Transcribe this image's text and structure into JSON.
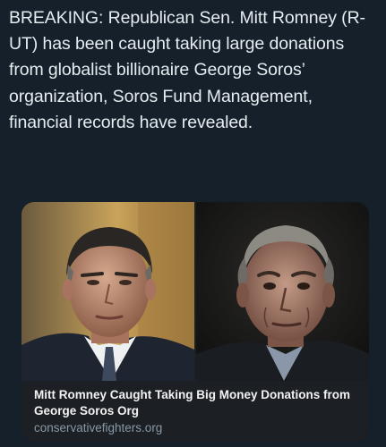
{
  "post": {
    "text": "BREAKING: Republican Sen. Mitt Romney (R-UT) has been caught taking large donations from globalist billionaire George Soros’ organization, Soros Fund Management, financial records have revealed."
  },
  "link_card": {
    "title": "Mitt Romney Caught Taking Big Money Donations from George Soros Org",
    "domain": "conservativefighters.org"
  },
  "colors": {
    "background": "#15202b",
    "text": "#e6ecf0",
    "muted": "#8899a6"
  }
}
